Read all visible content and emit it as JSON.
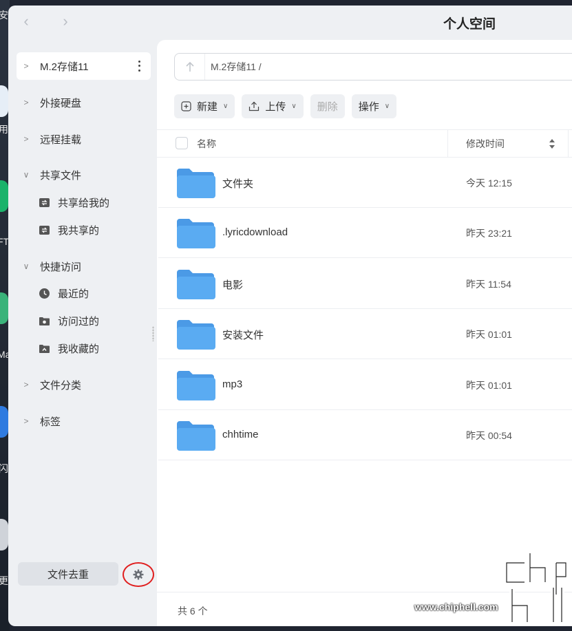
{
  "window": {
    "title": "个人空间"
  },
  "desktop": {
    "labels": [
      "安",
      "用",
      "FT",
      "Ma",
      "闪",
      "更"
    ]
  },
  "sidebar": {
    "current": "M.2存储11",
    "groups": [
      {
        "label": "外接硬盘",
        "expanded": false
      },
      {
        "label": "远程挂载",
        "expanded": false
      },
      {
        "label": "共享文件",
        "expanded": true,
        "items": [
          {
            "label": "共享给我的",
            "icon": "share-in-icon"
          },
          {
            "label": "我共享的",
            "icon": "share-out-icon"
          }
        ]
      },
      {
        "label": "快捷访问",
        "expanded": true,
        "items": [
          {
            "label": "最近的",
            "icon": "clock-icon"
          },
          {
            "label": "访问过的",
            "icon": "visited-folder-icon"
          },
          {
            "label": "我收藏的",
            "icon": "favorite-folder-icon"
          }
        ]
      },
      {
        "label": "文件分类",
        "expanded": false
      },
      {
        "label": "标签",
        "expanded": false
      }
    ],
    "dedupe_label": "文件去重"
  },
  "main": {
    "path": "M.2存储11 /",
    "toolbar": {
      "new": "新建",
      "upload": "上传",
      "delete": "删除",
      "actions": "操作"
    },
    "columns": {
      "name": "名称",
      "modified": "修改时间"
    },
    "files": [
      {
        "name": "文件夹",
        "modified": "今天 12:15"
      },
      {
        "name": ".lyricdownload",
        "modified": "昨天 23:21"
      },
      {
        "name": "电影",
        "modified": "昨天 11:54"
      },
      {
        "name": "安装文件",
        "modified": "昨天 01:01"
      },
      {
        "name": "mp3",
        "modified": "昨天 01:01"
      },
      {
        "name": "chhtime",
        "modified": "昨天 00:54"
      }
    ],
    "footer": {
      "count": "共 6 个"
    }
  },
  "watermark": {
    "logo": "chiphell",
    "url": "www.chiphell.com"
  },
  "colors": {
    "folder": "#5aabf2",
    "folder_tab": "#4b9ae6",
    "annotation": "#e02020"
  }
}
